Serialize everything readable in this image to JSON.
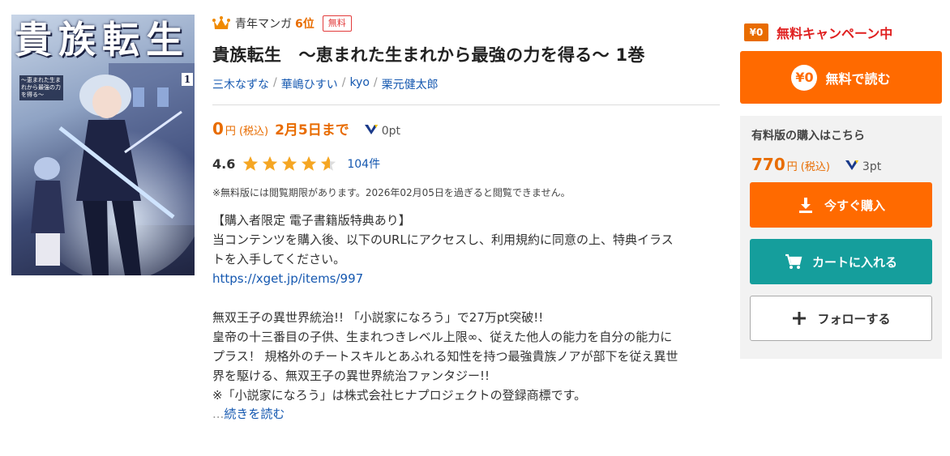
{
  "cover": {
    "title": "貴族転生",
    "subtitle": "〜恵まれた生まれから最強の力を得る〜",
    "volume": "1"
  },
  "rank": {
    "genre": "青年マンガ",
    "position": "6位",
    "badge": "無料"
  },
  "title": "貴族転生　〜恵まれた生まれから最強の力を得る〜 1巻",
  "authors": [
    "三木なずな",
    "華嶋ひすい",
    "kyo",
    "栗元健太郎"
  ],
  "author_separator": "/",
  "free_price": {
    "price": "0",
    "yen": "円",
    "tax": "(税込)",
    "until": "2月5日まで",
    "points": "0pt"
  },
  "rating": {
    "score": "4.6",
    "stars": 4.6,
    "count": "104件"
  },
  "notice": "※無料版には閲覧期限があります。2026年02月05日を過ぎると閲覧できません。",
  "description": {
    "lines": [
      "【購入者限定 電子書籍版特典あり】",
      "当コンテンツを購入後、以下のURLにアクセスし、利用規約に同意の上、特典イラス",
      "トを入手してください。"
    ],
    "link": "https://xget.jp/items/997",
    "lines2": [
      "無双王子の異世界統治!! 「小説家になろう」で27万pt突破!!",
      "皇帝の十三番目の子供、生まれつきレベル上限∞、従えた他人の能力を自分の能力に",
      "プラス！ 規格外のチートスキルとあふれる知性を持つ最強貴族ノアが部下を従え異世",
      "界を駆ける、無双王子の異世界統治ファンタジー!!",
      "※「小説家になろう」は株式会社ヒナプロジェクトの登録商標です。"
    ],
    "more_dots": "...",
    "more_label": "続きを読む"
  },
  "sidebar": {
    "campaign_tag": "¥0",
    "campaign_text": "無料キャンペーン中",
    "free_button_icon": "¥0",
    "free_button_label": "無料で読む",
    "paid_heading": "有料版の購入はこちら",
    "paid_price": "770",
    "paid_yen": "円",
    "paid_tax": "(税込)",
    "paid_points": "3pt",
    "buy_label": "今すぐ購入",
    "cart_label": "カートに入れる",
    "follow_label": "フォローする"
  },
  "colors": {
    "accent_orange": "#ff6a00",
    "price_orange": "#e86c00",
    "teal": "#159e9c",
    "link_blue": "#1558b0",
    "star_yellow": "#f5a623"
  }
}
